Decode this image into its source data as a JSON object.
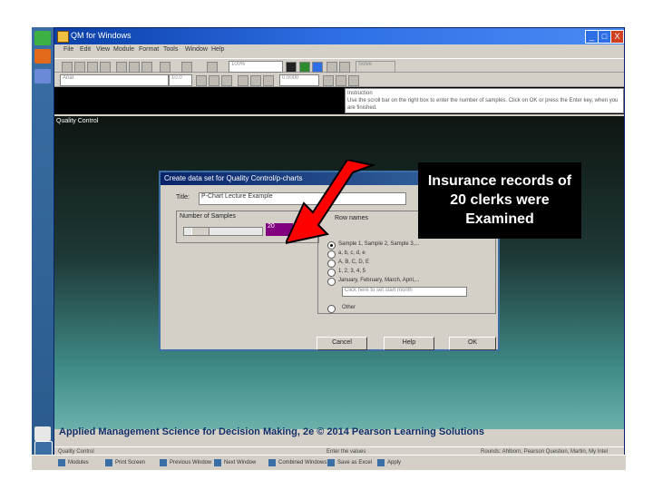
{
  "window": {
    "title": "QM for Windows",
    "min": "_",
    "max": "□",
    "close": "X"
  },
  "menus": [
    "File",
    "Edit",
    "View",
    "Module",
    "Format",
    "Tools",
    "Window",
    "Help"
  ],
  "toolbar": {
    "font_name": "Arial",
    "font_size": "10.0",
    "zoom": "100%",
    "solve_label": "Solve",
    "format_combo": "0.0000"
  },
  "instruction": {
    "heading": "Instruction",
    "text": "Use the scroll bar on the right box to enter the number of samples. Click on OK or press the Enter key, when you are finished."
  },
  "workspace_label": "Quality Control",
  "dialog": {
    "title": "Create data set for Quality Control/p-charts",
    "title_label": "Title:",
    "title_value": "P-Chart Lecture Example",
    "num_samples_label": "Number of Samples",
    "num_samples_value": "20",
    "row_names_label": "Row names",
    "options": [
      "Sample 1, Sample 2, Sample 3,...",
      "a, b, c, d, e",
      "A, B, C, D, E",
      "1, 2, 3, 4, 5",
      "January, February, March, April,..."
    ],
    "start_month_placeholder": "Click here to set start month",
    "other_option": "Other",
    "buttons": {
      "cancel": "Cancel",
      "help": "Help",
      "ok": "OK"
    }
  },
  "callout": {
    "text": "Insurance records of 20 clerks were Examined"
  },
  "footer": {
    "text": "Applied Management Science for Decision Making, 2e © 2014 Pearson Learning Solutions"
  },
  "statusbar": {
    "left": "Quality Control",
    "middle": "Enter the values",
    "right": "Rounds: Ahlborn, Pearson Question, Martin, My Intel"
  },
  "taskbar": [
    "Modules",
    "Print Screen",
    "Previous Window",
    "Next Window",
    "Combined Windows",
    "Save as Excel",
    "Apply"
  ],
  "colors": {
    "titlebar": "#2f6fe6",
    "callout_bg": "#000000",
    "arrow": "#ff0000",
    "number_field": "#800080"
  }
}
